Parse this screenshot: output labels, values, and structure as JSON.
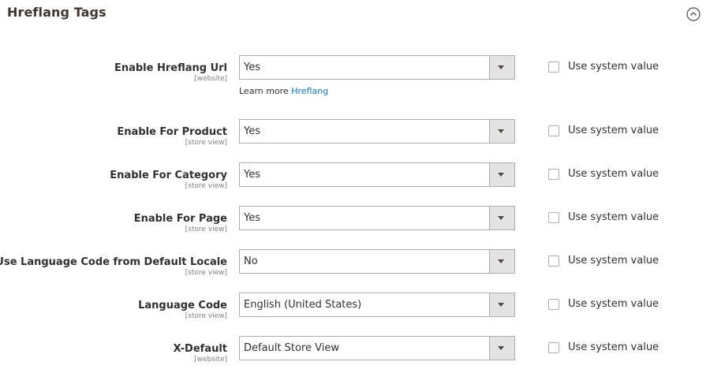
{
  "section": {
    "title": "Hreflang Tags"
  },
  "checkbox_label": "Use system value",
  "fields": [
    {
      "label": "Enable Hreflang Url",
      "scope": "[website]",
      "value": "Yes",
      "note_prefix": "Learn more",
      "note_link": "Hreflang"
    },
    {
      "label": "Enable For Product",
      "scope": "[store view]",
      "value": "Yes"
    },
    {
      "label": "Enable For Category",
      "scope": "[store view]",
      "value": "Yes"
    },
    {
      "label": "Enable For Page",
      "scope": "[store view]",
      "value": "Yes"
    },
    {
      "label": "Use Language Code from Default Locale",
      "scope": "[store view]",
      "value": "No"
    },
    {
      "label": "Language Code",
      "scope": "[store view]",
      "value": "English (United States)"
    },
    {
      "label": "X-Default",
      "scope": "[website]",
      "value": "Default Store View"
    }
  ],
  "colors": {
    "link": "#007bdb",
    "text": "#303030",
    "scope": "#808080",
    "border": "#adadad",
    "arrow_bg": "#e3e3e3"
  },
  "icons": {
    "collapse": "chevron-up-circle-icon",
    "select_arrow": "caret-down-icon"
  }
}
